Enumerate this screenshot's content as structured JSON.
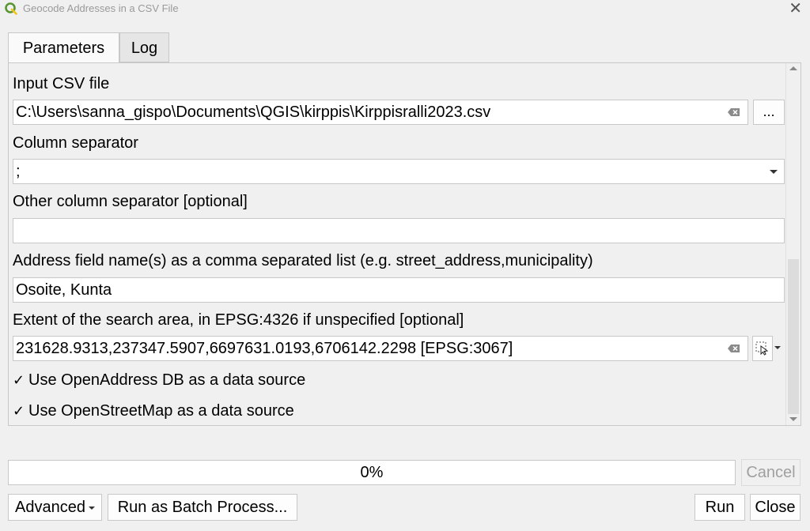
{
  "window": {
    "title": "Geocode Addresses in a CSV File"
  },
  "tabs": [
    {
      "label": "Parameters"
    },
    {
      "label": "Log"
    }
  ],
  "params": {
    "input_csv": {
      "label": "Input CSV file",
      "value": "C:\\Users\\sanna_gispo\\Documents\\QGIS\\kirppis\\Kirppisralli2023.csv",
      "browse_label": "..."
    },
    "column_separator": {
      "label": "Column separator",
      "value": ";"
    },
    "other_separator": {
      "label": "Other column separator [optional]",
      "value": ""
    },
    "address_fields": {
      "label": "Address field name(s) as a comma separated list (e.g. street_address,municipality)",
      "value": "Osoite, Kunta"
    },
    "extent": {
      "label": "Extent of the search area, in EPSG:4326 if unspecified [optional]",
      "value": "231628.9313,237347.5907,6697631.0193,6706142.2298 [EPSG:3067]"
    },
    "use_openaddress": {
      "label": "Use OpenAddress DB as a data source",
      "checked": true
    },
    "use_osm": {
      "label": "Use OpenStreetMap as a data source",
      "checked": true
    }
  },
  "progress": {
    "value": 0,
    "text": "0%"
  },
  "buttons": {
    "advanced": "Advanced",
    "batch": "Run as Batch Process...",
    "run": "Run",
    "close": "Close",
    "cancel": "Cancel"
  },
  "icons": {
    "app": "qgis-logo-icon",
    "clear": "clear-field-icon",
    "extent_select": "map-select-cursor-icon"
  },
  "colors": {
    "accent": "#589632",
    "accent2": "#f0c419"
  }
}
